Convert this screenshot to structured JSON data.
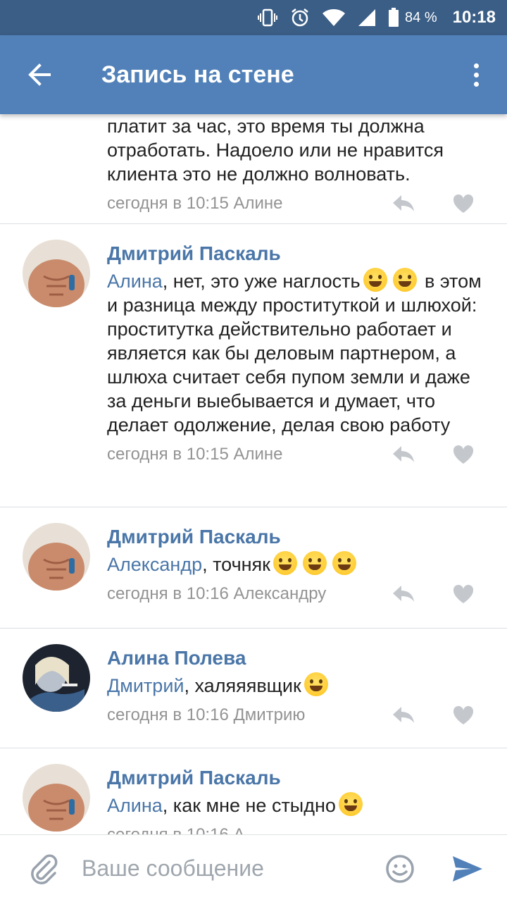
{
  "status_bar": {
    "battery": "84 %",
    "time": "10:18"
  },
  "app_bar": {
    "title": "Запись на стене"
  },
  "colors": {
    "header": "#5181b8",
    "status_bar": "#3b5e86",
    "link": "#4a76a8",
    "meta": "#939393"
  },
  "comments": [
    {
      "text_lines": [
        "платит за час, это время ты должна",
        "отработать. Надоело или не нравится",
        "клиента это не должно волновать."
      ],
      "time": "сегодня в 10:15 Алине"
    },
    {
      "author": "Дмитрий Паскаль",
      "mention": "Алина",
      "text_a": ", нет, это уже наглость",
      "text_b": " в этом и разница между проституткой и шлюхой: проститутка действительно работает и является как бы деловым партнером, а шлюха считает себя пупом земли и даже за деньги выебывается и думает, что делает одолжение, делая свою работу",
      "time": "сегодня в 10:15 Алине"
    },
    {
      "author": "Дмитрий Паскаль",
      "mention": "Александр",
      "text": ", точняк",
      "time": "сегодня в 10:16 Александру"
    },
    {
      "author": "Алина Полева",
      "mention": "Дмитрий",
      "text": ", халяяявщик",
      "time": "сегодня в 10:16 Дмитрию"
    },
    {
      "author": "Дмитрий Паскаль",
      "mention": "Алина",
      "text": ", как мне не стыдно",
      "time": "сегодня в 10:16 А"
    }
  ],
  "composer": {
    "placeholder": "Ваше сообщение"
  },
  "icons": {
    "back": "arrow-left-icon",
    "menu": "more-vertical-icon",
    "reply": "reply-icon",
    "like": "heart-icon",
    "attach": "paperclip-icon",
    "emoji": "smiley-icon",
    "send": "send-icon"
  }
}
